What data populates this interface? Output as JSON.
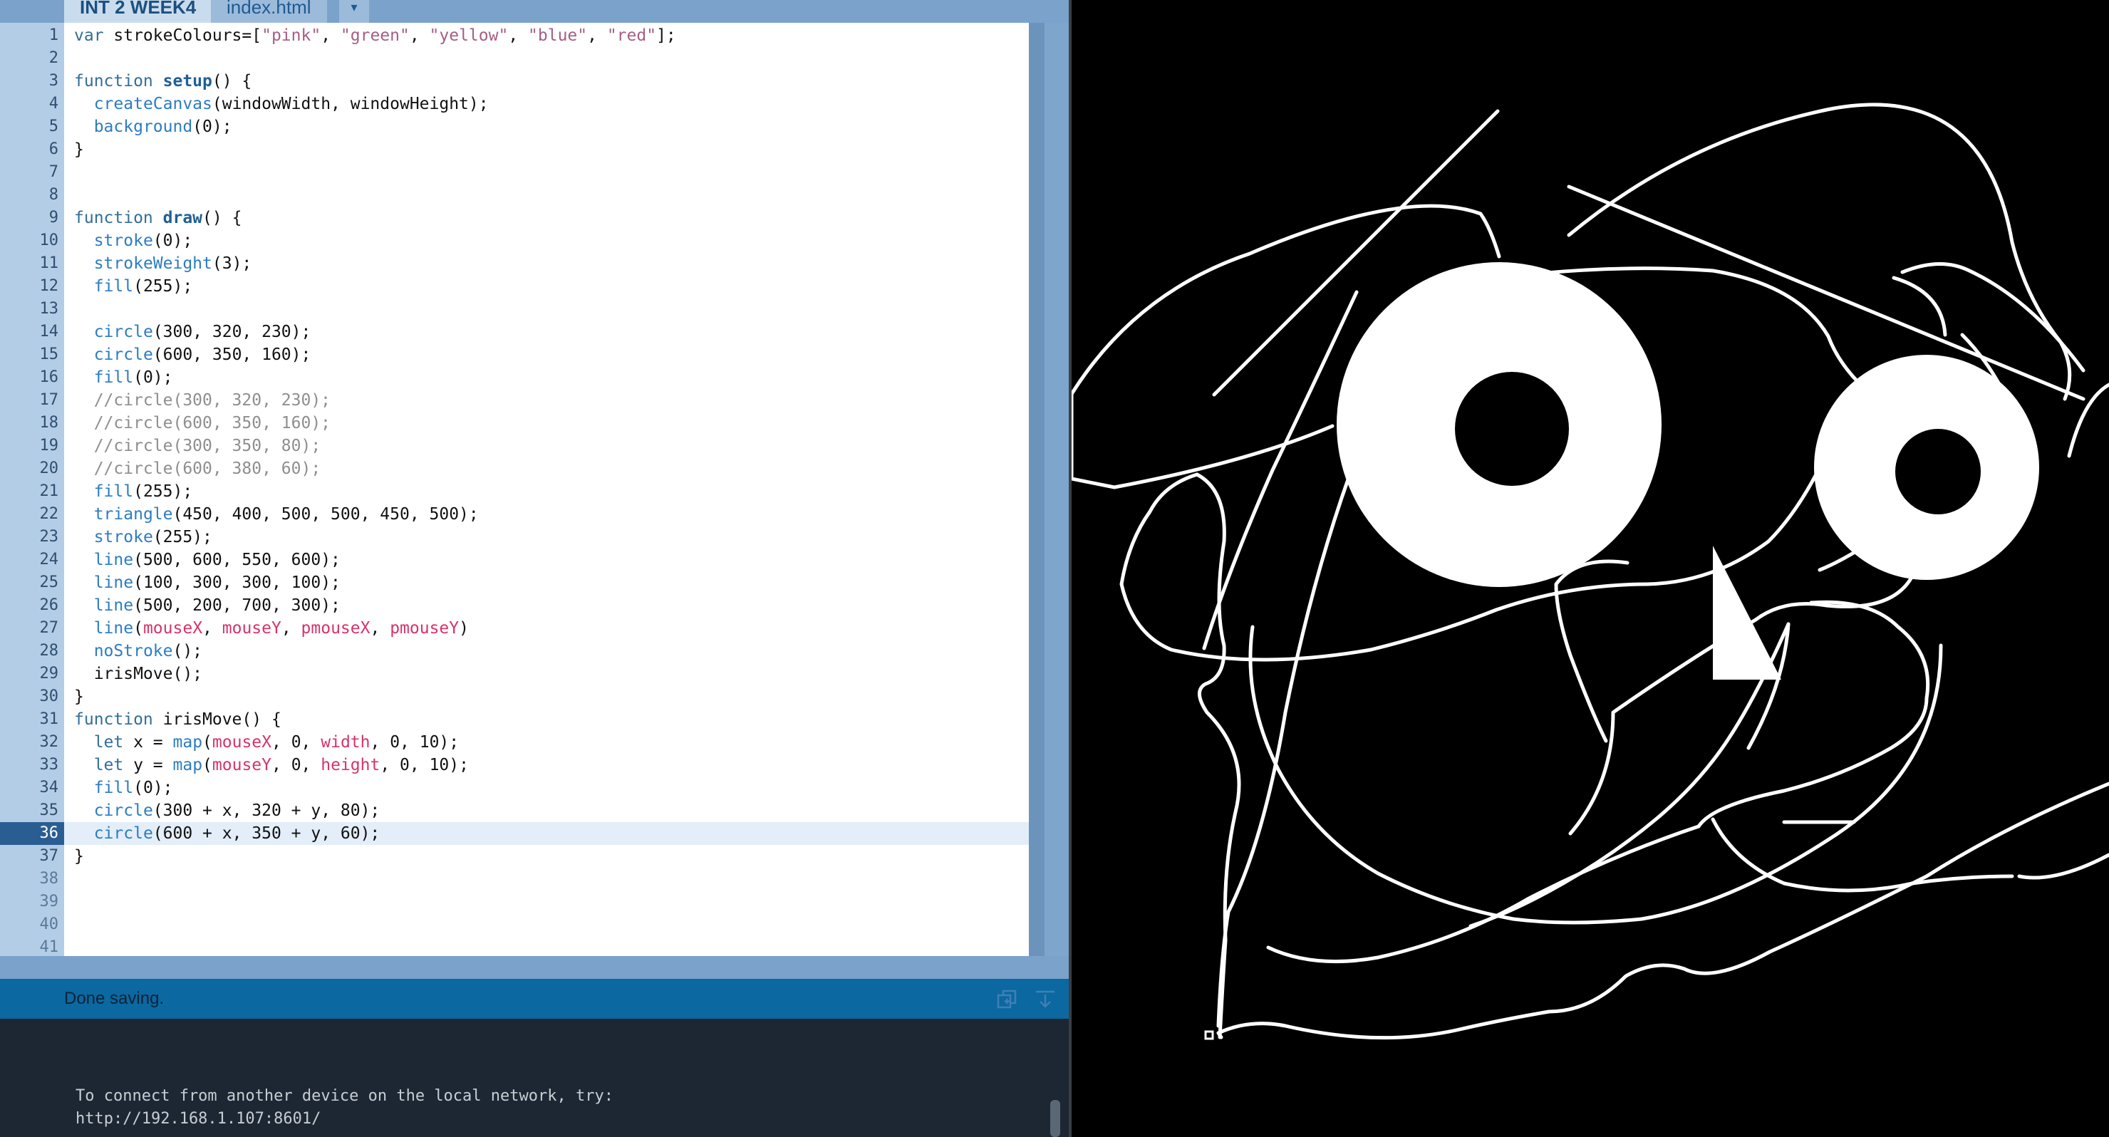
{
  "tabs": [
    {
      "label": "INT 2 WEEK4",
      "active": true
    },
    {
      "label": "index.html",
      "active": false
    }
  ],
  "tab_menu_icon": "chevron-down-icon",
  "editor": {
    "current_line": 36,
    "line_numbers": [
      "1",
      "2",
      "3",
      "4",
      "5",
      "6",
      "7",
      "8",
      "9",
      "10",
      "11",
      "12",
      "13",
      "14",
      "15",
      "16",
      "17",
      "18",
      "19",
      "20",
      "21",
      "22",
      "23",
      "24",
      "25",
      "26",
      "27",
      "28",
      "29",
      "30",
      "31",
      "32",
      "33",
      "34",
      "35",
      "36",
      "37",
      "38",
      "39",
      "40",
      "41"
    ],
    "code_lines": [
      "var strokeColours=[\"pink\", \"green\", \"yellow\", \"blue\", \"red\"];",
      "",
      "function setup() {",
      "  createCanvas(windowWidth, windowHeight);",
      "  background(0);",
      "}",
      "",
      "",
      "function draw() {",
      "  stroke(0);",
      "  strokeWeight(3);",
      "  fill(255);",
      "",
      "  circle(300, 320, 230);",
      "  circle(600, 350, 160);",
      "  fill(0);",
      "  //circle(300, 320, 230);",
      "  //circle(600, 350, 160);",
      "  //circle(300, 350, 80);",
      "  //circle(600, 380, 60);",
      "  fill(255);",
      "  triangle(450, 400, 500, 500, 450, 500);",
      "  stroke(255);",
      "  line(500, 600, 550, 600);",
      "  line(100, 300, 300, 100);",
      "  line(500, 200, 700, 300);",
      "  line(mouseX, mouseY, pmouseX, pmouseY)",
      "  noStroke();",
      "  irisMove();",
      "}",
      "function irisMove() {",
      "  let x = map(mouseX, 0, width, 0, 10);",
      "  let y = map(mouseY, 0, height, 0, 10);",
      "  fill(0);",
      "  circle(300 + x, 320 + y, 80);",
      "  circle(600 + x, 350 + y, 60);",
      "}"
    ]
  },
  "status": {
    "message": "Done saving.",
    "copy_icon": "copy-icon",
    "clear_icon": "clear-console-icon"
  },
  "console": {
    "lines": [
      "To connect from another device on the local network, try:",
      "http://192.168.1.107:8601/"
    ]
  },
  "colors": {
    "editor_bg": "#ffffff",
    "gutter_bg": "#b4cde6",
    "status_bg": "#0b68a0",
    "console_bg": "#1d2733",
    "sketch_bg": "#000000",
    "sketch_fg": "#ffffff"
  }
}
